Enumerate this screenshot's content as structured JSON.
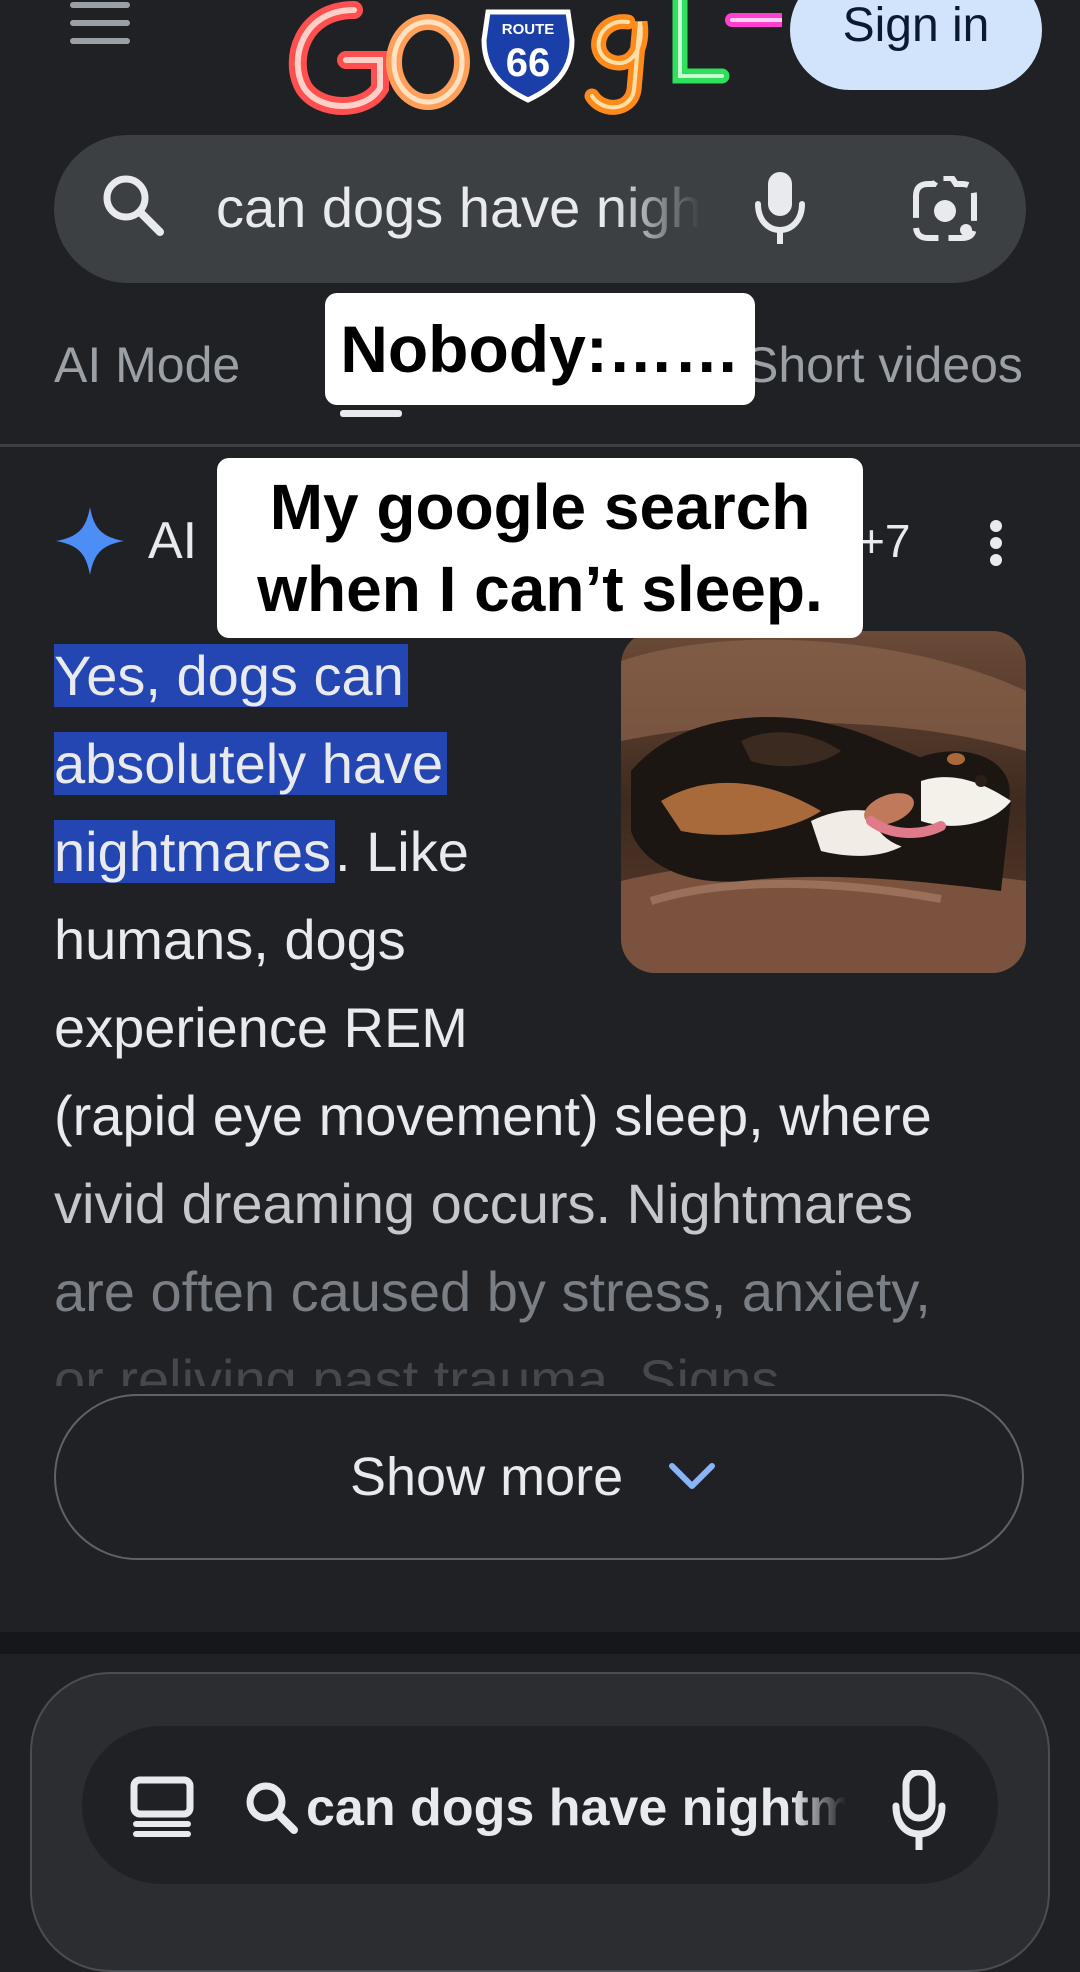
{
  "header": {
    "menu_icon": "hamburger-menu-icon",
    "doodle": {
      "sign_text": "ROUTE",
      "sign_number": "66"
    },
    "sign_in_label": "Sign in"
  },
  "search": {
    "query": "can dogs have nightmares",
    "search_icon": "search-icon",
    "mic_icon": "microphone-icon",
    "lens_icon": "google-lens-icon"
  },
  "tabs": [
    {
      "label": "AI Mode",
      "selected": false
    },
    {
      "label": "Short videos",
      "selected": false
    }
  ],
  "captions": {
    "top": "Nobody:……",
    "middle_line1": "My google search",
    "middle_line2": "when I can’t sleep."
  },
  "ai_overview": {
    "label": "AI",
    "sources_count": "+7",
    "highlight_lines": [
      "Yes, dogs can",
      "absolutely have",
      "nightmares"
    ],
    "after_highlight": ". Like",
    "lines": [
      "humans, dogs",
      "experience REM",
      "(rapid eye movement) sleep, where",
      "vivid dreaming occurs. Nightmares",
      "are often caused by stress, anxiety,",
      "or reliving past trauma. Signs"
    ],
    "image_alt": "dog sleeping on leather couch"
  },
  "show_more": {
    "label": "Show more"
  },
  "bottom_bar": {
    "tabs_icon": "tabs-icon",
    "query": "can dogs have nightmares",
    "mic_icon": "microphone-icon"
  },
  "colors": {
    "background": "#1f2125",
    "search_bar": "#3c4043",
    "highlight": "#2446b3",
    "sign_in_bg": "#d2e3fc",
    "sparkle": "#4c8df6"
  }
}
